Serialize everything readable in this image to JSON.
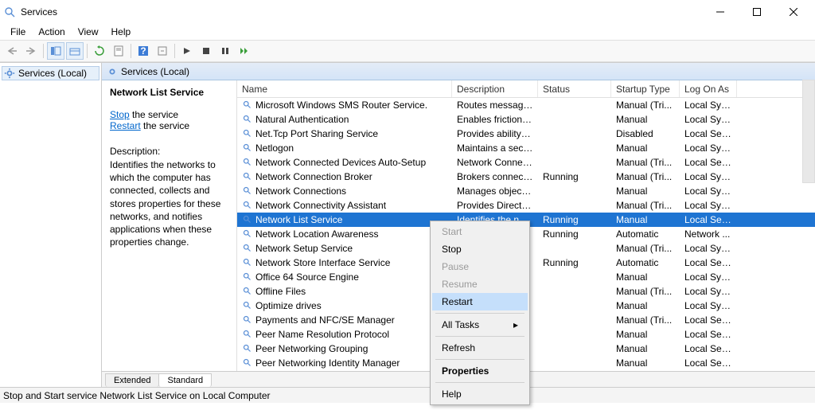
{
  "window": {
    "title": "Services",
    "status_bar": "Stop and Start service Network List Service on Local Computer"
  },
  "menubar": [
    "File",
    "Action",
    "View",
    "Help"
  ],
  "tree": {
    "root": "Services (Local)"
  },
  "right_header": "Services (Local)",
  "detail": {
    "name": "Network List Service",
    "stop_link": "Stop",
    "stop_suffix": " the service",
    "restart_link": "Restart",
    "restart_suffix": " the service",
    "desc_label": "Description:",
    "desc_text": "Identifies the networks to which the computer has connected, collects and stores properties for these networks, and notifies applications when these properties change."
  },
  "columns": {
    "name": "Name",
    "desc": "Description",
    "status": "Status",
    "startup": "Startup Type",
    "logon": "Log On As"
  },
  "rows": [
    {
      "n": "Microsoft Windows SMS Router Service.",
      "d": "Routes messages...",
      "s": "",
      "t": "Manual (Tri...",
      "l": "Local Syst..."
    },
    {
      "n": "Natural Authentication",
      "d": "Enables friction-fr...",
      "s": "",
      "t": "Manual",
      "l": "Local Syst..."
    },
    {
      "n": "Net.Tcp Port Sharing Service",
      "d": "Provides ability t...",
      "s": "",
      "t": "Disabled",
      "l": "Local Serv..."
    },
    {
      "n": "Netlogon",
      "d": "Maintains a secur...",
      "s": "",
      "t": "Manual",
      "l": "Local Syst..."
    },
    {
      "n": "Network Connected Devices Auto-Setup",
      "d": "Network Connect...",
      "s": "",
      "t": "Manual (Tri...",
      "l": "Local Serv..."
    },
    {
      "n": "Network Connection Broker",
      "d": "Brokers connecti...",
      "s": "Running",
      "t": "Manual (Tri...",
      "l": "Local Syst..."
    },
    {
      "n": "Network Connections",
      "d": "Manages objects...",
      "s": "",
      "t": "Manual",
      "l": "Local Syst..."
    },
    {
      "n": "Network Connectivity Assistant",
      "d": "Provides DirectAc...",
      "s": "",
      "t": "Manual (Tri...",
      "l": "Local Syst..."
    },
    {
      "n": "Network List Service",
      "d": "Identifies the net...",
      "s": "Running",
      "t": "Manual",
      "l": "Local Serv...",
      "sel": true
    },
    {
      "n": "Network Location Awareness",
      "d": "",
      "s": "Running",
      "t": "Automatic",
      "l": "Network ..."
    },
    {
      "n": "Network Setup Service",
      "d": "u...",
      "s": "",
      "t": "Manual (Tri...",
      "l": "Local Syst..."
    },
    {
      "n": "Network Store Interface Service",
      "d": "...",
      "s": "Running",
      "t": "Automatic",
      "l": "Local Serv..."
    },
    {
      "n": "Office 64 Source Engine",
      "d": "",
      "s": "",
      "t": "Manual",
      "l": "Local Syst..."
    },
    {
      "n": "Offline Files",
      "d": "",
      "s": "",
      "t": "Manual (Tri...",
      "l": "Local Syst..."
    },
    {
      "n": "Optimize drives",
      "d": "",
      "s": "",
      "t": "Manual",
      "l": "Local Syst..."
    },
    {
      "n": "Payments and NFC/SE Manager",
      "d": "",
      "s": "",
      "t": "Manual (Tri...",
      "l": "Local Serv..."
    },
    {
      "n": "Peer Name Resolution Protocol",
      "d": "",
      "s": "",
      "t": "Manual",
      "l": "Local Serv..."
    },
    {
      "n": "Peer Networking Grouping",
      "d": "",
      "s": "",
      "t": "Manual",
      "l": "Local Serv..."
    },
    {
      "n": "Peer Networking Identity Manager",
      "d": "",
      "s": "",
      "t": "Manual",
      "l": "Local Serv..."
    }
  ],
  "tabs": {
    "extended": "Extended",
    "standard": "Standard"
  },
  "context_menu": {
    "start": "Start",
    "stop": "Stop",
    "pause": "Pause",
    "resume": "Resume",
    "restart": "Restart",
    "all_tasks": "All Tasks",
    "refresh": "Refresh",
    "properties": "Properties",
    "help": "Help"
  }
}
